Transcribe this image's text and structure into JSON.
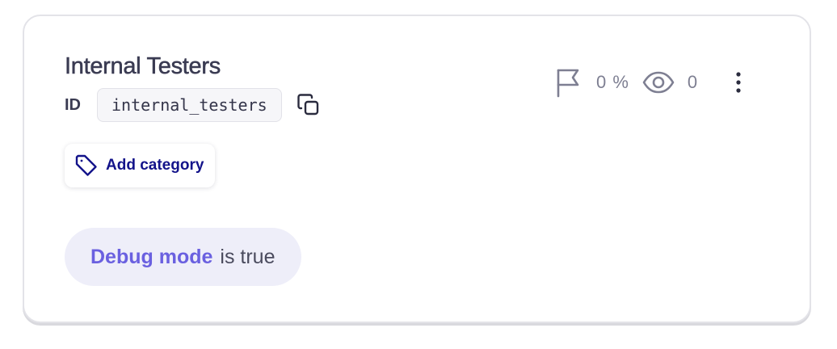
{
  "segment": {
    "title": "Internal Testers",
    "id_label": "ID",
    "id_value": "internal_testers"
  },
  "stats": {
    "percentage": "0 %",
    "views": "0"
  },
  "category_button": {
    "label": "Add category"
  },
  "condition": {
    "trait": "Debug mode",
    "operator_text": "is true"
  },
  "icons": {
    "copy": "copy-icon",
    "tag": "tag-icon",
    "flag": "flag-icon",
    "eye": "eye-icon",
    "more": "more-vertical-icon"
  },
  "colors": {
    "title": "#3a3b52",
    "accent_dark": "#13138a",
    "trait": "#6a60e0",
    "pill_bg": "#eeeef9",
    "muted": "#7e7f92"
  }
}
